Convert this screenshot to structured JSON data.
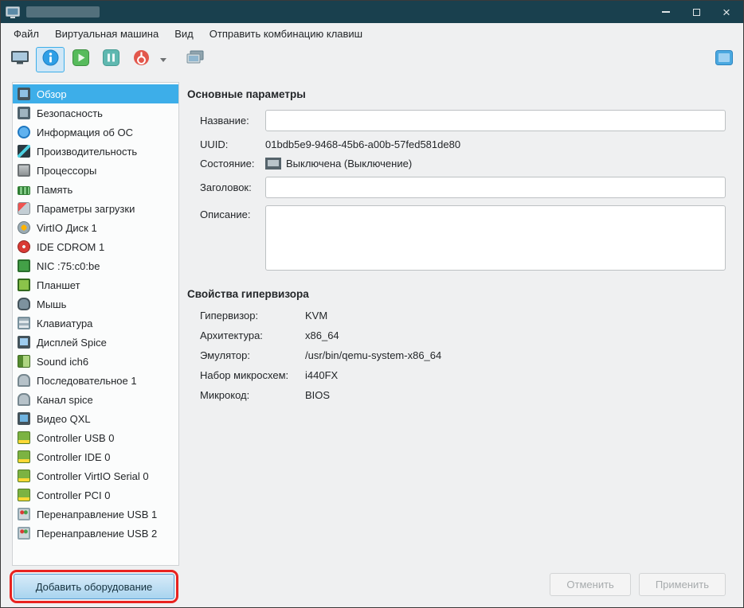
{
  "window": {
    "title_redacted": "",
    "controls": {
      "minimize": "minimize",
      "maximize": "maximize",
      "close": "×"
    }
  },
  "menu": {
    "items": [
      {
        "id": "file",
        "label": "Файл"
      },
      {
        "id": "vm",
        "label": "Виртуальная машина"
      },
      {
        "id": "view",
        "label": "Вид"
      },
      {
        "id": "send-key",
        "label": "Отправить комбинацию клавиш"
      }
    ]
  },
  "toolbar": {
    "icons": [
      "console-monitor-icon",
      "info-details-icon",
      "run-play-icon",
      "pause-icon",
      "shutdown-power-icon",
      "dropdown-caret-icon",
      "snapshots-icon",
      "fullscreen-icon"
    ]
  },
  "sidebar": {
    "items": [
      {
        "id": "overview",
        "label": "Обзор",
        "icon": "overview-monitor-icon",
        "selected": true
      },
      {
        "id": "security",
        "label": "Безопасность",
        "icon": "security-icon",
        "selected": false
      },
      {
        "id": "os-info",
        "label": "Информация об ОС",
        "icon": "os-info-icon",
        "selected": false
      },
      {
        "id": "performance",
        "label": "Производительность",
        "icon": "performance-icon",
        "selected": false
      },
      {
        "id": "processors",
        "label": "Процессоры",
        "icon": "cpu-icon",
        "selected": false
      },
      {
        "id": "memory",
        "label": "Память",
        "icon": "memory-icon",
        "selected": false
      },
      {
        "id": "boot-options",
        "label": "Параметры загрузки",
        "icon": "boot-icon",
        "selected": false
      },
      {
        "id": "virtio-disk-1",
        "label": "VirtIO Диск 1",
        "icon": "disk-icon",
        "selected": false
      },
      {
        "id": "ide-cdrom-1",
        "label": "IDE CDROM 1",
        "icon": "cdrom-icon",
        "selected": false
      },
      {
        "id": "nic",
        "label": "NIC :75:c0:be",
        "icon": "network-icon",
        "selected": false
      },
      {
        "id": "tablet",
        "label": "Планшет",
        "icon": "tablet-icon",
        "selected": false
      },
      {
        "id": "mouse",
        "label": "Мышь",
        "icon": "mouse-icon",
        "selected": false
      },
      {
        "id": "keyboard",
        "label": "Клавиатура",
        "icon": "keyboard-icon",
        "selected": false
      },
      {
        "id": "display-spice",
        "label": "Дисплей Spice",
        "icon": "display-icon",
        "selected": false
      },
      {
        "id": "sound-ich6",
        "label": "Sound ich6",
        "icon": "sound-icon",
        "selected": false
      },
      {
        "id": "serial-1",
        "label": "Последовательное 1",
        "icon": "serial-icon",
        "selected": false
      },
      {
        "id": "channel-spice",
        "label": "Канал spice",
        "icon": "channel-icon",
        "selected": false
      },
      {
        "id": "video-qxl",
        "label": "Видео QXL",
        "icon": "video-icon",
        "selected": false
      },
      {
        "id": "controller-usb-0",
        "label": "Controller USB 0",
        "icon": "controller-icon",
        "selected": false
      },
      {
        "id": "controller-ide-0",
        "label": "Controller IDE 0",
        "icon": "controller-icon",
        "selected": false
      },
      {
        "id": "controller-virtio-serial-0",
        "label": "Controller VirtIO Serial 0",
        "icon": "controller-icon",
        "selected": false
      },
      {
        "id": "controller-pci-0",
        "label": "Controller PCI 0",
        "icon": "controller-icon",
        "selected": false
      },
      {
        "id": "usb-redir-1",
        "label": "Перенаправление USB 1",
        "icon": "usb-icon",
        "selected": false
      },
      {
        "id": "usb-redir-2",
        "label": "Перенаправление USB 2",
        "icon": "usb-icon",
        "selected": false
      }
    ],
    "add_hardware_label": "Добавить оборудование"
  },
  "main": {
    "basic": {
      "heading": "Основные параметры",
      "name_label": "Название:",
      "name_value": "",
      "uuid_label": "UUID:",
      "uuid_value": "01bdb5e9-9468-45b6-a00b-57fed581de80",
      "state_label": "Состояние:",
      "state_value": "Выключена (Выключение)",
      "title_label": "Заголовок:",
      "title_value": "",
      "description_label": "Описание:",
      "description_value": ""
    },
    "hypervisor": {
      "heading": "Свойства гипервизора",
      "rows": [
        {
          "label": "Гипервизор:",
          "value": "KVM"
        },
        {
          "label": "Архитектура:",
          "value": "x86_64"
        },
        {
          "label": "Эмулятор:",
          "value": "/usr/bin/qemu-system-x86_64"
        },
        {
          "label": "Набор микросхем:",
          "value": "i440FX"
        },
        {
          "label": "Микрокод:",
          "value": "BIOS"
        }
      ]
    }
  },
  "footer": {
    "cancel_label": "Отменить",
    "apply_label": "Применить"
  }
}
